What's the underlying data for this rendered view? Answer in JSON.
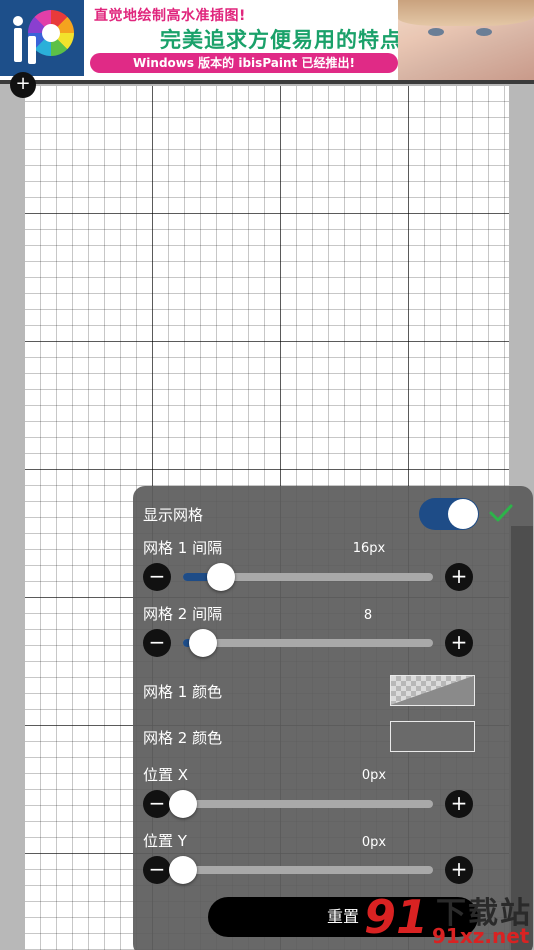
{
  "banner": {
    "line1": "直觉地绘制高水准插图!",
    "line2": "完美追求方便易用的特点!",
    "line3": "Windows 版本的 ibisPaint 已经推出!"
  },
  "canvas": {
    "badge": "+"
  },
  "grid_panel": {
    "show_grid": {
      "label": "显示网格",
      "on": true
    },
    "grid1_spacing": {
      "label": "网格 1 间隔",
      "value": "16px",
      "level": 0.15
    },
    "grid2_spacing": {
      "label": "网格 2 间隔",
      "value": "8",
      "level": 0.08
    },
    "grid1_color": {
      "label": "网格 1 颜色"
    },
    "grid2_color": {
      "label": "网格 2 颜色"
    },
    "position_x": {
      "label": "位置 X",
      "value": "0px",
      "level": 0.0
    },
    "position_y": {
      "label": "位置 Y",
      "value": "0px",
      "level": 0.0
    },
    "minus": "−",
    "plus": "+",
    "reset_label": "重置"
  },
  "watermark": {
    "badge": "91",
    "title": "下载站",
    "url": "91xz.net"
  },
  "colors": {
    "accent": "#1e4c87",
    "panel_bg": "#5c5c5c",
    "confirm": "#2db34a"
  }
}
